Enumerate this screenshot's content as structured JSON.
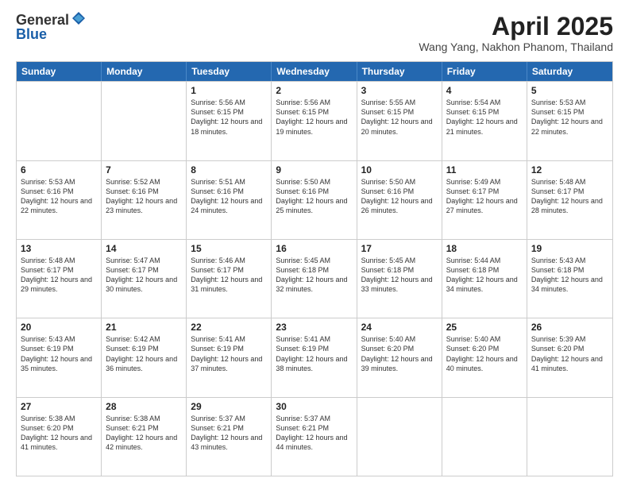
{
  "header": {
    "logo_general": "General",
    "logo_blue": "Blue",
    "month_title": "April 2025",
    "location": "Wang Yang, Nakhon Phanom, Thailand"
  },
  "calendar": {
    "days_of_week": [
      "Sunday",
      "Monday",
      "Tuesday",
      "Wednesday",
      "Thursday",
      "Friday",
      "Saturday"
    ],
    "weeks": [
      [
        {
          "day": "",
          "info": ""
        },
        {
          "day": "",
          "info": ""
        },
        {
          "day": "1",
          "info": "Sunrise: 5:56 AM\nSunset: 6:15 PM\nDaylight: 12 hours and 18 minutes."
        },
        {
          "day": "2",
          "info": "Sunrise: 5:56 AM\nSunset: 6:15 PM\nDaylight: 12 hours and 19 minutes."
        },
        {
          "day": "3",
          "info": "Sunrise: 5:55 AM\nSunset: 6:15 PM\nDaylight: 12 hours and 20 minutes."
        },
        {
          "day": "4",
          "info": "Sunrise: 5:54 AM\nSunset: 6:15 PM\nDaylight: 12 hours and 21 minutes."
        },
        {
          "day": "5",
          "info": "Sunrise: 5:53 AM\nSunset: 6:15 PM\nDaylight: 12 hours and 22 minutes."
        }
      ],
      [
        {
          "day": "6",
          "info": "Sunrise: 5:53 AM\nSunset: 6:16 PM\nDaylight: 12 hours and 22 minutes."
        },
        {
          "day": "7",
          "info": "Sunrise: 5:52 AM\nSunset: 6:16 PM\nDaylight: 12 hours and 23 minutes."
        },
        {
          "day": "8",
          "info": "Sunrise: 5:51 AM\nSunset: 6:16 PM\nDaylight: 12 hours and 24 minutes."
        },
        {
          "day": "9",
          "info": "Sunrise: 5:50 AM\nSunset: 6:16 PM\nDaylight: 12 hours and 25 minutes."
        },
        {
          "day": "10",
          "info": "Sunrise: 5:50 AM\nSunset: 6:16 PM\nDaylight: 12 hours and 26 minutes."
        },
        {
          "day": "11",
          "info": "Sunrise: 5:49 AM\nSunset: 6:17 PM\nDaylight: 12 hours and 27 minutes."
        },
        {
          "day": "12",
          "info": "Sunrise: 5:48 AM\nSunset: 6:17 PM\nDaylight: 12 hours and 28 minutes."
        }
      ],
      [
        {
          "day": "13",
          "info": "Sunrise: 5:48 AM\nSunset: 6:17 PM\nDaylight: 12 hours and 29 minutes."
        },
        {
          "day": "14",
          "info": "Sunrise: 5:47 AM\nSunset: 6:17 PM\nDaylight: 12 hours and 30 minutes."
        },
        {
          "day": "15",
          "info": "Sunrise: 5:46 AM\nSunset: 6:17 PM\nDaylight: 12 hours and 31 minutes."
        },
        {
          "day": "16",
          "info": "Sunrise: 5:45 AM\nSunset: 6:18 PM\nDaylight: 12 hours and 32 minutes."
        },
        {
          "day": "17",
          "info": "Sunrise: 5:45 AM\nSunset: 6:18 PM\nDaylight: 12 hours and 33 minutes."
        },
        {
          "day": "18",
          "info": "Sunrise: 5:44 AM\nSunset: 6:18 PM\nDaylight: 12 hours and 34 minutes."
        },
        {
          "day": "19",
          "info": "Sunrise: 5:43 AM\nSunset: 6:18 PM\nDaylight: 12 hours and 34 minutes."
        }
      ],
      [
        {
          "day": "20",
          "info": "Sunrise: 5:43 AM\nSunset: 6:19 PM\nDaylight: 12 hours and 35 minutes."
        },
        {
          "day": "21",
          "info": "Sunrise: 5:42 AM\nSunset: 6:19 PM\nDaylight: 12 hours and 36 minutes."
        },
        {
          "day": "22",
          "info": "Sunrise: 5:41 AM\nSunset: 6:19 PM\nDaylight: 12 hours and 37 minutes."
        },
        {
          "day": "23",
          "info": "Sunrise: 5:41 AM\nSunset: 6:19 PM\nDaylight: 12 hours and 38 minutes."
        },
        {
          "day": "24",
          "info": "Sunrise: 5:40 AM\nSunset: 6:20 PM\nDaylight: 12 hours and 39 minutes."
        },
        {
          "day": "25",
          "info": "Sunrise: 5:40 AM\nSunset: 6:20 PM\nDaylight: 12 hours and 40 minutes."
        },
        {
          "day": "26",
          "info": "Sunrise: 5:39 AM\nSunset: 6:20 PM\nDaylight: 12 hours and 41 minutes."
        }
      ],
      [
        {
          "day": "27",
          "info": "Sunrise: 5:38 AM\nSunset: 6:20 PM\nDaylight: 12 hours and 41 minutes."
        },
        {
          "day": "28",
          "info": "Sunrise: 5:38 AM\nSunset: 6:21 PM\nDaylight: 12 hours and 42 minutes."
        },
        {
          "day": "29",
          "info": "Sunrise: 5:37 AM\nSunset: 6:21 PM\nDaylight: 12 hours and 43 minutes."
        },
        {
          "day": "30",
          "info": "Sunrise: 5:37 AM\nSunset: 6:21 PM\nDaylight: 12 hours and 44 minutes."
        },
        {
          "day": "",
          "info": ""
        },
        {
          "day": "",
          "info": ""
        },
        {
          "day": "",
          "info": ""
        }
      ]
    ]
  }
}
